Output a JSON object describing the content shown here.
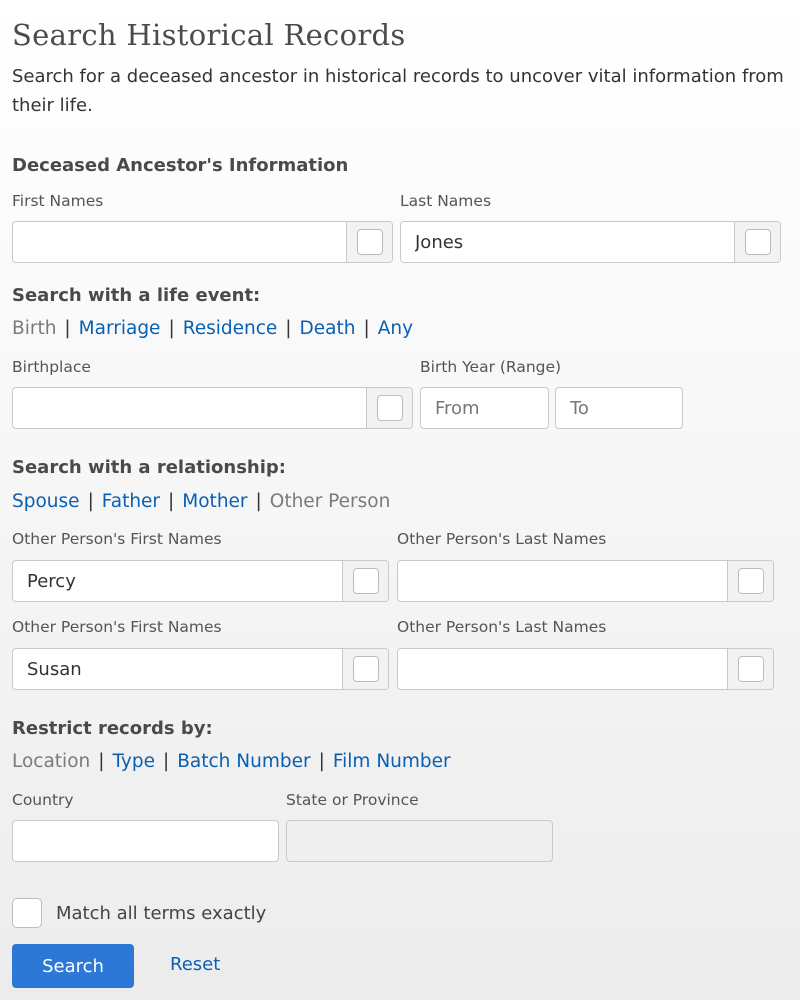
{
  "page": {
    "title": "Search Historical Records",
    "intro": "Search for a deceased ancestor in historical records to uncover vital information from their life."
  },
  "ancestor": {
    "heading": "Deceased Ancestor's Information",
    "first_names_label": "First Names",
    "first_names_value": "",
    "last_names_label": "Last Names",
    "last_names_value": "Jones"
  },
  "life_event": {
    "heading": "Search with a life event:",
    "tabs": [
      "Birth",
      "Marriage",
      "Residence",
      "Death",
      "Any"
    ],
    "active_tab": "Birth",
    "birthplace_label": "Birthplace",
    "birthplace_value": "",
    "birth_year_label": "Birth Year (Range)",
    "from_placeholder": "From",
    "to_placeholder": "To"
  },
  "relationship": {
    "heading": "Search with a relationship:",
    "tabs": [
      "Spouse",
      "Father",
      "Mother",
      "Other Person"
    ],
    "active_tab": "Other Person",
    "rows": [
      {
        "first_label": "Other Person's First Names",
        "first_value": "Percy",
        "last_label": "Other Person's Last Names",
        "last_value": ""
      },
      {
        "first_label": "Other Person's First Names",
        "first_value": "Susan",
        "last_label": "Other Person's Last Names",
        "last_value": ""
      }
    ]
  },
  "restrict": {
    "heading": "Restrict records by:",
    "tabs": [
      "Location",
      "Type",
      "Batch Number",
      "Film Number"
    ],
    "active_tab": "Location",
    "country_label": "Country",
    "country_value": "",
    "state_label": "State or Province",
    "state_value": ""
  },
  "options": {
    "match_exact_label": "Match all terms exactly",
    "match_exact_checked": false
  },
  "actions": {
    "search_label": "Search",
    "reset_label": "Reset"
  },
  "colors": {
    "link": "#0b5fb3",
    "primary_button": "#2d78d7",
    "active_tab": "#7a7a7a"
  }
}
